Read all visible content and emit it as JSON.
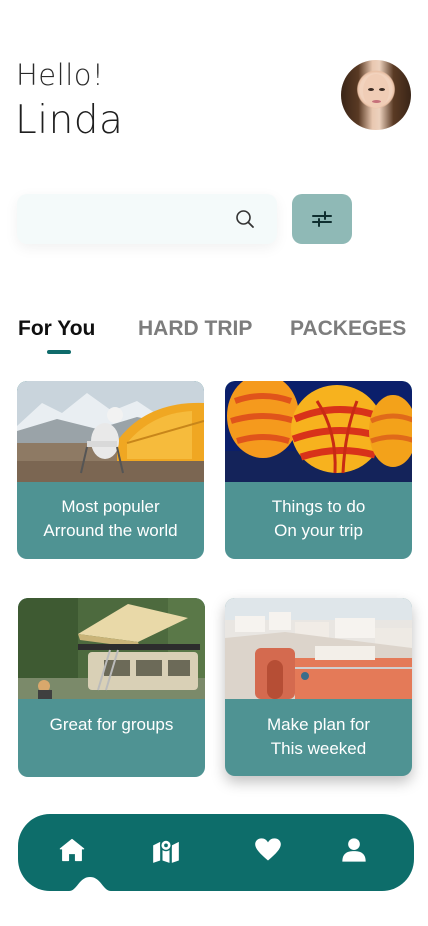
{
  "greeting": {
    "hello": "Hello!",
    "name": "Linda"
  },
  "search": {
    "value": "",
    "placeholder": ""
  },
  "tabs": [
    {
      "label": "For You",
      "active": true
    },
    {
      "label": "HARD TRIP",
      "active": false
    },
    {
      "label": "PACKEGES",
      "active": false
    }
  ],
  "cards": [
    {
      "line1": "Most populer",
      "line2": "Arround the world"
    },
    {
      "line1": "Things to do",
      "line2": "On your trip"
    },
    {
      "line1": "Great for groups"
    },
    {
      "line1": "Make plan for",
      "line2": "This weeked"
    }
  ],
  "colors": {
    "accent": "#0d6d6a",
    "card": "#4f9393",
    "filter": "#8fb9b6"
  },
  "nav": {
    "icons": [
      "home-icon",
      "map-icon",
      "heart-icon",
      "user-icon"
    ],
    "active": "home-icon"
  }
}
